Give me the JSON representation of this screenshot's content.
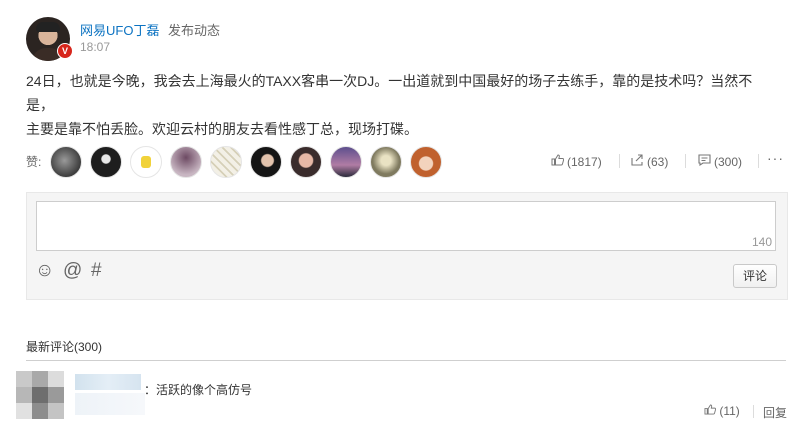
{
  "post": {
    "author": "网易UFO丁磊",
    "action": "发布动态",
    "time": "18:07",
    "verified_badge": "V",
    "text_line1": "24日，也就是今晚，我会去上海最火的TAXX客串一次DJ。一出道就到中国最好的场子去练手，靠的是技术吗？当然不是，",
    "text_line2": "主要是靠不怕丢脸。欢迎云村的朋友去看性感丁总，现场打碟。"
  },
  "likes": {
    "label": "赞:",
    "like_count": "(1817)",
    "share_count": "(63)",
    "comment_count": "(300)",
    "icons": {
      "like": "thumbs-up-icon",
      "share": "share-icon",
      "comment": "comment-icon"
    }
  },
  "composer": {
    "char_count": "140",
    "submit_label": "评论",
    "tools": [
      "emoji-icon",
      "mention-icon",
      "hashtag-icon"
    ],
    "tool_glyphs": {
      "emoji": "☺",
      "mention": "@",
      "hashtag": "#"
    }
  },
  "comments": {
    "header": "最新评论(300)",
    "items": [
      {
        "text": "：活跃的像个高仿号",
        "likes": "(11)",
        "reply": "回复"
      }
    ]
  },
  "colors": {
    "link": "#0c73c2",
    "badge": "#d7261c",
    "text": "#333333",
    "muted": "#999999"
  }
}
